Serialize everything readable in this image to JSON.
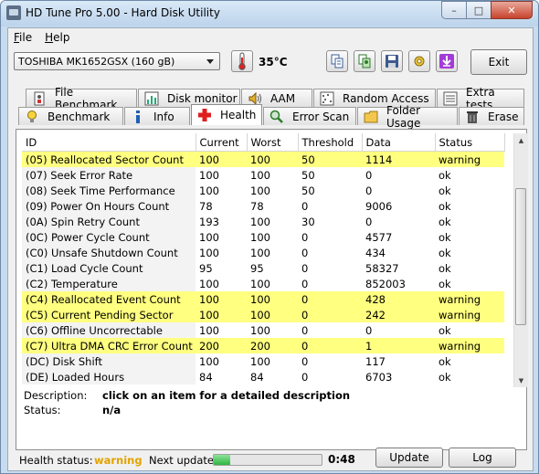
{
  "window": {
    "title": "HD Tune Pro 5.00 - Hard Disk Utility",
    "controls": {
      "minimize": "–",
      "maximize": "□",
      "close": "✕"
    }
  },
  "menu": {
    "items": [
      {
        "accel": "F",
        "rest": "ile"
      },
      {
        "accel": "H",
        "rest": "elp"
      }
    ]
  },
  "toolbar": {
    "drive": "TOSHIBA MK1652GSX (160 gB)",
    "temperature": "35°C",
    "exit_label": "Exit"
  },
  "tabs": {
    "row1": [
      "File Benchmark",
      "Disk monitor",
      "AAM",
      "Random Access",
      "Extra tests"
    ],
    "row2": [
      "Benchmark",
      "Info",
      "Health",
      "Error Scan",
      "Folder Usage",
      "Erase"
    ],
    "active": "Health"
  },
  "table": {
    "columns": [
      "ID",
      "Current",
      "Worst",
      "Threshold",
      "Data",
      "Status"
    ],
    "rows": [
      {
        "id": "(05) Reallocated Sector Count",
        "current": "100",
        "worst": "100",
        "threshold": "50",
        "data": "1114",
        "status": "warning",
        "highlight": true
      },
      {
        "id": "(07) Seek Error Rate",
        "current": "100",
        "worst": "100",
        "threshold": "50",
        "data": "0",
        "status": "ok",
        "highlight": false
      },
      {
        "id": "(08) Seek Time Performance",
        "current": "100",
        "worst": "100",
        "threshold": "50",
        "data": "0",
        "status": "ok",
        "highlight": false
      },
      {
        "id": "(09) Power On Hours Count",
        "current": "78",
        "worst": "78",
        "threshold": "0",
        "data": "9006",
        "status": "ok",
        "highlight": false
      },
      {
        "id": "(0A) Spin Retry Count",
        "current": "193",
        "worst": "100",
        "threshold": "30",
        "data": "0",
        "status": "ok",
        "highlight": false
      },
      {
        "id": "(0C) Power Cycle Count",
        "current": "100",
        "worst": "100",
        "threshold": "0",
        "data": "4577",
        "status": "ok",
        "highlight": false
      },
      {
        "id": "(C0) Unsafe Shutdown Count",
        "current": "100",
        "worst": "100",
        "threshold": "0",
        "data": "434",
        "status": "ok",
        "highlight": false
      },
      {
        "id": "(C1) Load Cycle Count",
        "current": "95",
        "worst": "95",
        "threshold": "0",
        "data": "58327",
        "status": "ok",
        "highlight": false
      },
      {
        "id": "(C2) Temperature",
        "current": "100",
        "worst": "100",
        "threshold": "0",
        "data": "852003",
        "status": "ok",
        "highlight": false
      },
      {
        "id": "(C4) Reallocated Event Count",
        "current": "100",
        "worst": "100",
        "threshold": "0",
        "data": "428",
        "status": "warning",
        "highlight": true
      },
      {
        "id": "(C5) Current Pending Sector",
        "current": "100",
        "worst": "100",
        "threshold": "0",
        "data": "242",
        "status": "warning",
        "highlight": true
      },
      {
        "id": "(C6) Offline Uncorrectable",
        "current": "100",
        "worst": "100",
        "threshold": "0",
        "data": "0",
        "status": "ok",
        "highlight": false
      },
      {
        "id": "(C7) Ultra DMA CRC Error Count",
        "current": "200",
        "worst": "200",
        "threshold": "0",
        "data": "1",
        "status": "warning",
        "highlight": true
      },
      {
        "id": "(DC) Disk Shift",
        "current": "100",
        "worst": "100",
        "threshold": "0",
        "data": "117",
        "status": "ok",
        "highlight": false
      },
      {
        "id": "(DE) Loaded Hours",
        "current": "84",
        "worst": "84",
        "threshold": "0",
        "data": "6703",
        "status": "ok",
        "highlight": false
      }
    ]
  },
  "description": {
    "label": "Description:",
    "value": "click on an item for a detailed description"
  },
  "status": {
    "label": "Status:",
    "value": "n/a"
  },
  "footer": {
    "health_label": "Health status:",
    "health_value": "warning",
    "next_update_label": "Next update:",
    "progress_fraction": 0.15,
    "countdown": "0:48",
    "update_label": "Update",
    "log_label": "Log"
  },
  "colors": {
    "warning_row": "#ffff80",
    "warning_text": "#e2a300",
    "progress": "#2db640",
    "title_gradient": "#c7dcef"
  }
}
